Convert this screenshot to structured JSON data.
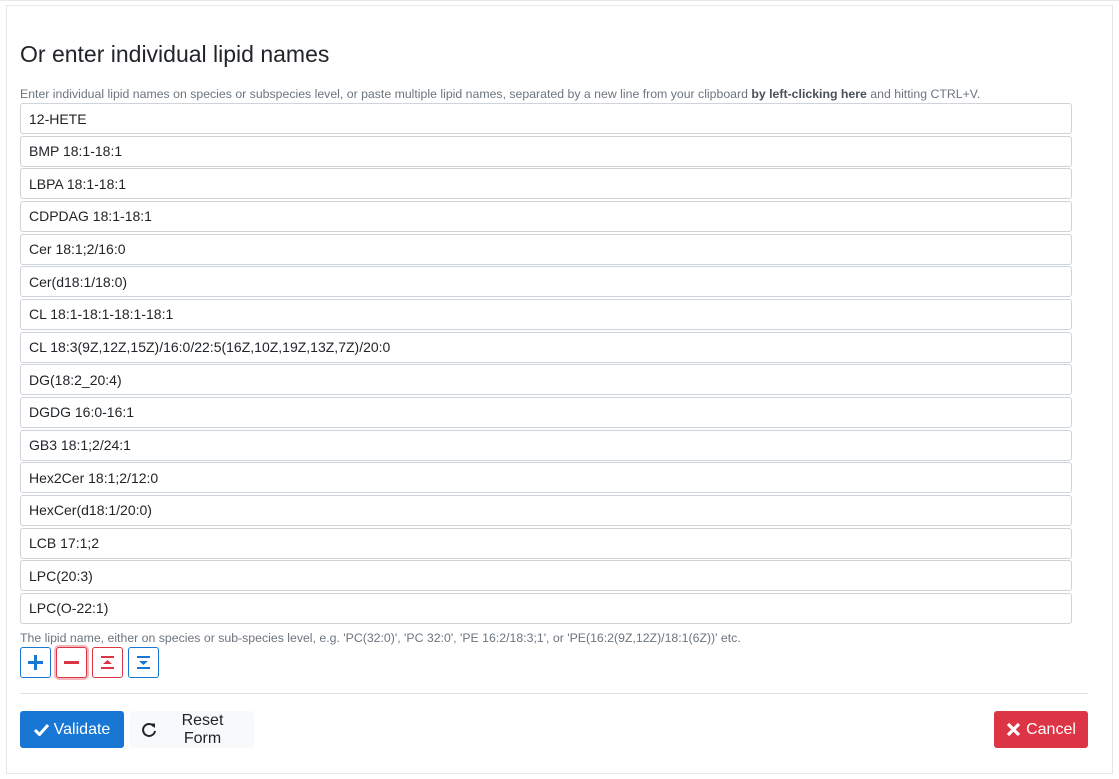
{
  "section": {
    "title": "Or enter individual lipid names",
    "help_prefix": "Enter individual lipid names on species or subspecies level, or paste multiple lipid names, separated by a new line from your clipboard ",
    "help_link": "by left-clicking here",
    "help_suffix": " and hitting CTRL+V."
  },
  "lipids": [
    "12-HETE",
    "BMP 18:1-18:1",
    "LBPA 18:1-18:1",
    "CDPDAG 18:1-18:1",
    "Cer 18:1;2/16:0",
    "Cer(d18:1/18:0)",
    "CL 18:1-18:1-18:1-18:1",
    "CL 18:3(9Z,12Z,15Z)/16:0/22:5(16Z,10Z,19Z,13Z,7Z)/20:0",
    "DG(18:2_20:4)",
    "DGDG 16:0-16:1",
    "GB3 18:1;2/24:1",
    "Hex2Cer 18:1;2/12:0",
    "HexCer(d18:1/20:0)",
    "LCB 17:1;2",
    "LPC(20:3)",
    "LPC(O-22:1)"
  ],
  "hint": "The lipid name, either on species or sub-species level, e.g. 'PC(32:0)', 'PC 32:0', 'PE 16:2/18:3;1', or 'PE(16:2(9Z,12Z)/18:1(6Z))' etc.",
  "tools": {
    "add_icon": "plus-icon",
    "remove_icon": "minus-icon",
    "collapse_icon": "collapse-icon",
    "expand_icon": "expand-icon"
  },
  "actions": {
    "validate_label": "Validate",
    "reset_label": "Reset Form",
    "cancel_label": "Cancel"
  },
  "colors": {
    "primary": "#1877d4",
    "danger": "#dc3545",
    "muted": "#6c757d"
  }
}
